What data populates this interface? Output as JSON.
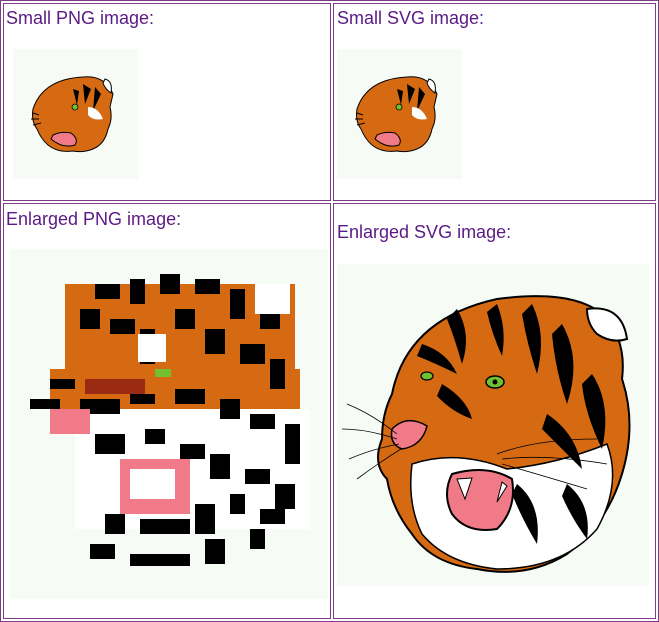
{
  "page": {
    "cells": [
      {
        "id": "small-png",
        "label": "Small PNG image:"
      },
      {
        "id": "small-svg",
        "label": "Small SVG image:"
      },
      {
        "id": "enlarged-png",
        "label": "Enlarged PNG image:"
      },
      {
        "id": "enlarged-svg",
        "label": "Enlarged SVG image:"
      }
    ]
  },
  "colors": {
    "border": "#7a3e82",
    "label": "#5b1a86",
    "image_background": "#f6fbf6",
    "tiger_orange": "#d66a12",
    "tiger_black": "#000000",
    "tiger_white": "#ffffff",
    "tiger_pink": "#f07a88",
    "tiger_eye": "#70c030"
  },
  "icons": {
    "small_png": "tiger-head-icon",
    "small_svg": "tiger-head-icon",
    "enlarged_png": "tiger-head-pixelated-icon",
    "enlarged_svg": "tiger-head-icon"
  }
}
